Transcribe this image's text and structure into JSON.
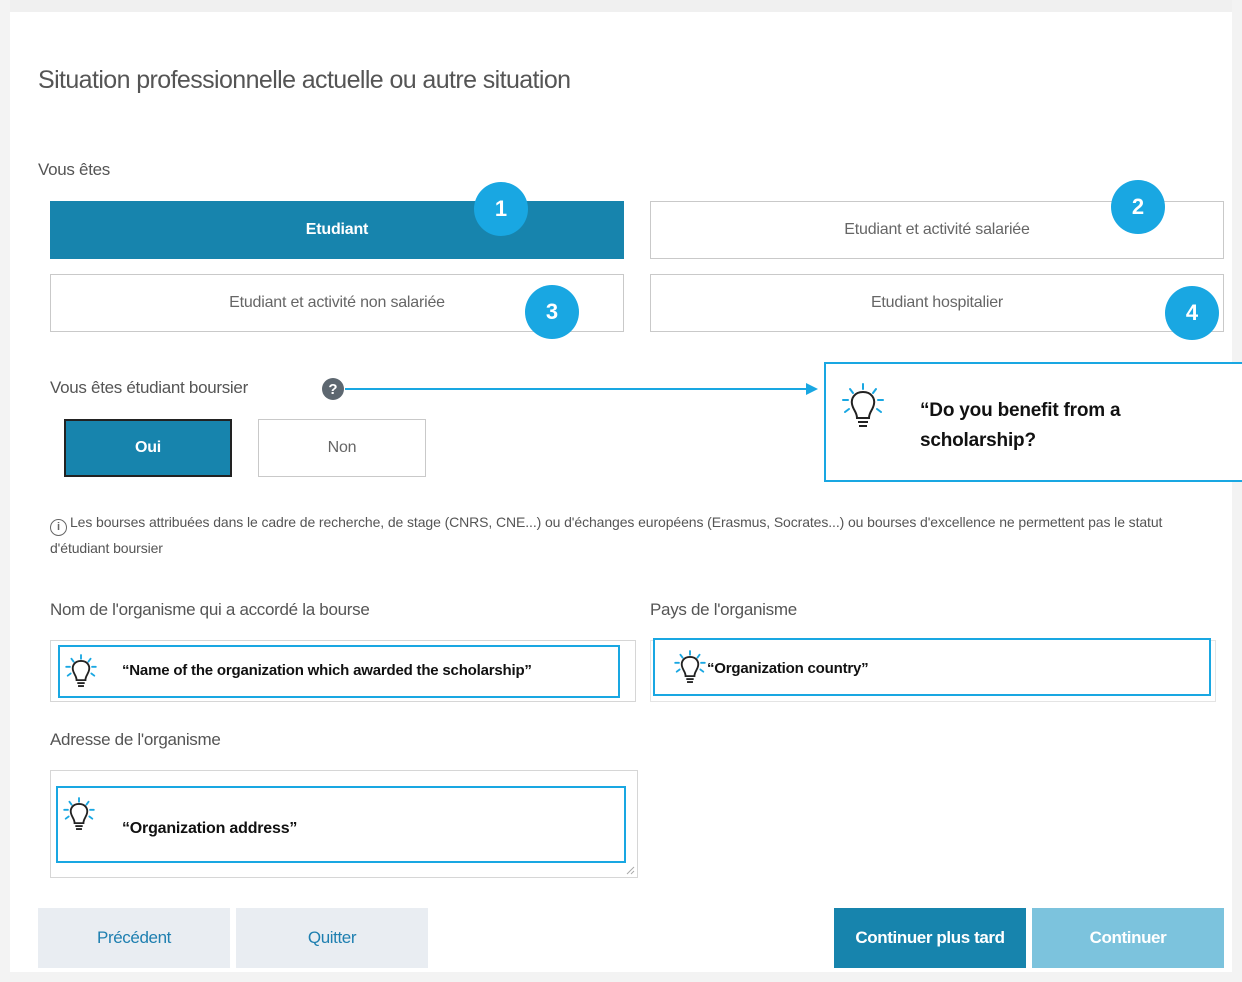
{
  "page_title": "Situation professionnelle actuelle ou autre situation",
  "vous_etes": {
    "label": "Vous êtes",
    "options": [
      {
        "label": "Etudiant",
        "selected": true
      },
      {
        "label": "Etudiant et activité salariée",
        "selected": false
      },
      {
        "label": "Etudiant et activité non salariée",
        "selected": false
      },
      {
        "label": "Etudiant hospitalier",
        "selected": false
      }
    ]
  },
  "badges": [
    "1",
    "2",
    "3",
    "4"
  ],
  "boursier": {
    "label": "Vous êtes étudiant boursier",
    "help_icon": "?",
    "yes": "Oui",
    "no": "Non",
    "selected": "Oui"
  },
  "info_icon": "i",
  "info_note": "Les bourses attribuées dans le cadre de recherche, de stage (CNRS, CNE...) ou d'échanges européens (Erasmus, Socrates...) ou bourses d'excellence ne permettent pas le statut d'étudiant boursier",
  "fields": {
    "org_name_label": "Nom de l'organisme qui a accordé la bourse",
    "org_country_label": "Pays de l'organisme",
    "org_address_label": "Adresse de l'organisme"
  },
  "callouts": {
    "scholarship": "“Do you benefit from a scholarship?",
    "org_name": "“Name of the organization which awarded the scholarship”",
    "org_country": "“Organization country”",
    "org_address": "“Organization address”"
  },
  "buttons": {
    "previous": "Précédent",
    "quit": "Quitter",
    "continue_later": "Continuer plus tard",
    "continue": "Continuer"
  },
  "colors": {
    "primary": "#1784ad",
    "badge": "#19a7e2",
    "callout_border": "#19a7e2",
    "continue_disabled": "#7cc3dd"
  }
}
